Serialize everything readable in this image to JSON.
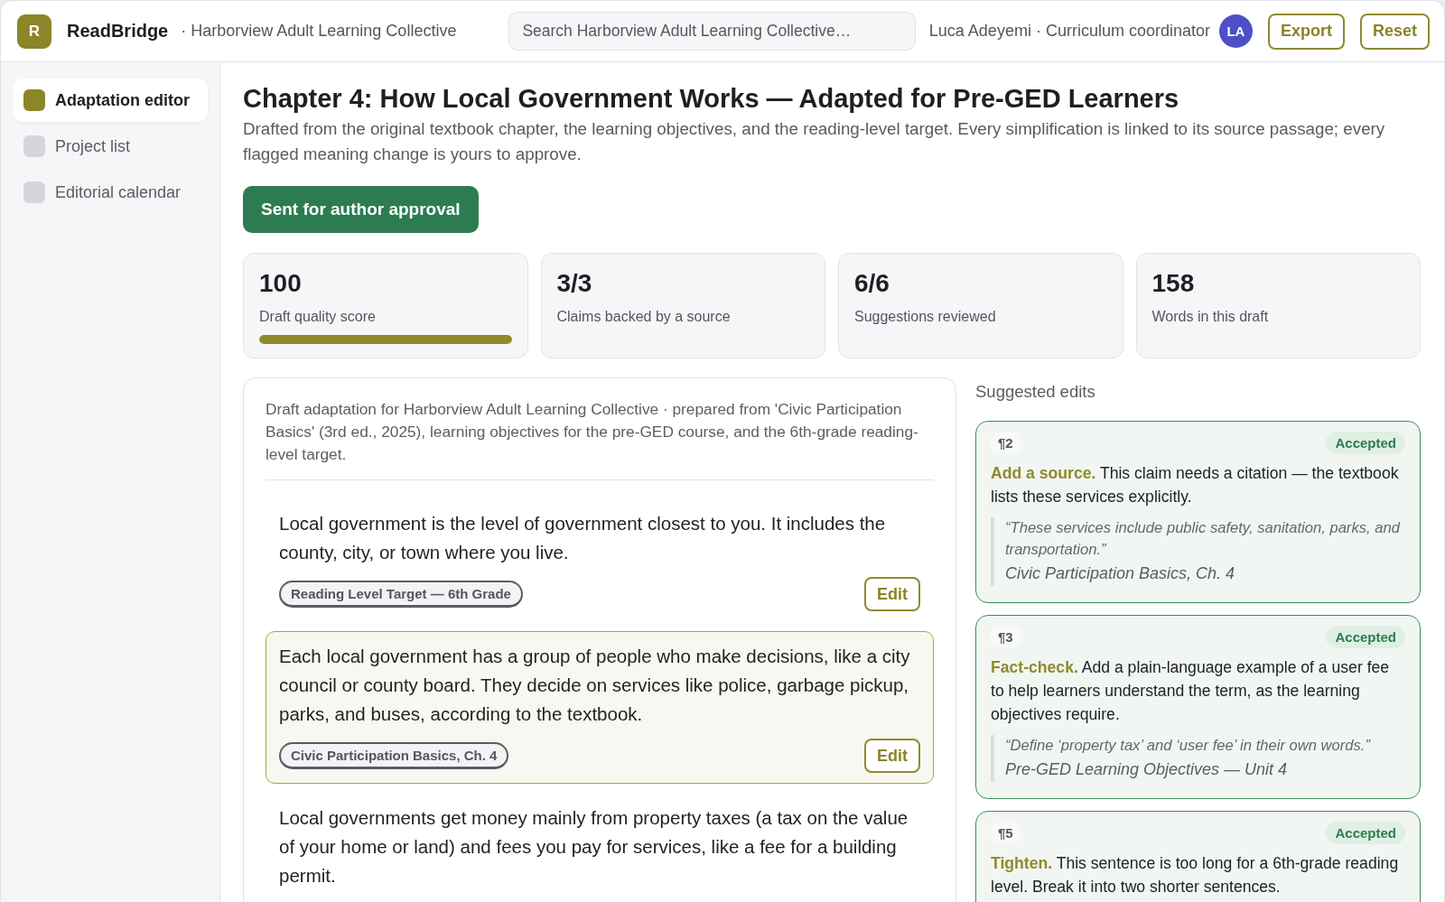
{
  "app": {
    "logo_letter": "R",
    "name": "ReadBridge",
    "workspace": "· Harborview Adult Learning Collective"
  },
  "search": {
    "placeholder": "Search Harborview Adult Learning Collective…"
  },
  "user": {
    "name": "Luca Adeyemi · Curriculum coordinator",
    "initials": "LA"
  },
  "top_actions": [
    {
      "label": "Export"
    },
    {
      "label": "Reset"
    }
  ],
  "sidebar": {
    "items": [
      {
        "label": "Adaptation editor",
        "selected": true
      },
      {
        "label": "Project list",
        "selected": false
      },
      {
        "label": "Editorial calendar",
        "selected": false
      }
    ]
  },
  "page": {
    "title": "Chapter 4: How Local Government Works — Adapted for Pre-GED Learners",
    "description": "Drafted from the original textbook chapter, the learning objectives, and the reading-level target. Every simplification is linked to its source passage; every flagged meaning change is yours to approve.",
    "status_button": "Sent for author approval"
  },
  "stats": [
    {
      "value": "100",
      "label": "Draft quality score",
      "level": 1
    },
    {
      "value": "3/3",
      "label": "Claims backed by a source"
    },
    {
      "value": "6/6",
      "label": "Suggestions reviewed"
    },
    {
      "value": "158",
      "label": "Words in this draft"
    }
  ],
  "draft": {
    "intro": "Draft adaptation for Harborview Adult Learning Collective · prepared from 'Civic Participation Basics' (3rd ed., 2025), learning objectives for the pre-GED course, and the 6th-grade reading-level target.",
    "paragraphs": [
      {
        "text": "Local government is the level of government closest to you. It includes the county, city, or town where you live.",
        "tag": "Reading Level Target — 6th Grade",
        "action": "Edit",
        "selected": false
      },
      {
        "text": "Each local government has a group of people who make decisions, like a city council or county board. They decide on services like police, garbage pickup, parks, and buses, according to the textbook.",
        "tag": "Civic Participation Basics, Ch. 4",
        "action": "Edit",
        "selected": true
      },
      {
        "text": "Local governments get money mainly from property taxes (a tax on the value of your home or land) and fees you pay for services, like a fee for a building permit.",
        "selected": false
      }
    ]
  },
  "suggestions": {
    "title": "Suggested edits",
    "items": [
      {
        "paragraph": "¶2",
        "status": "Accepted",
        "text": "**Add a source.** This claim needs a citation — the textbook lists these services explicitly.",
        "quote": "“These services include public safety, sanitation, parks, and transportation.”",
        "source": "Civic Participation Basics, Ch. 4"
      },
      {
        "paragraph": "¶3",
        "status": "Accepted",
        "text": "**Fact-check.** Add a plain-language example of a user fee to help learners understand the term, as the learning objectives require.",
        "quote": "“Define ‘property tax’ and ‘user fee’ in their own words.”",
        "source": "Pre-GED Learning Objectives — Unit 4"
      },
      {
        "paragraph": "¶5",
        "status": "Accepted",
        "text": "**Tighten.** This sentence is too long for a 6th-grade reading level. Break it into two shorter sentences."
      }
    ]
  }
}
